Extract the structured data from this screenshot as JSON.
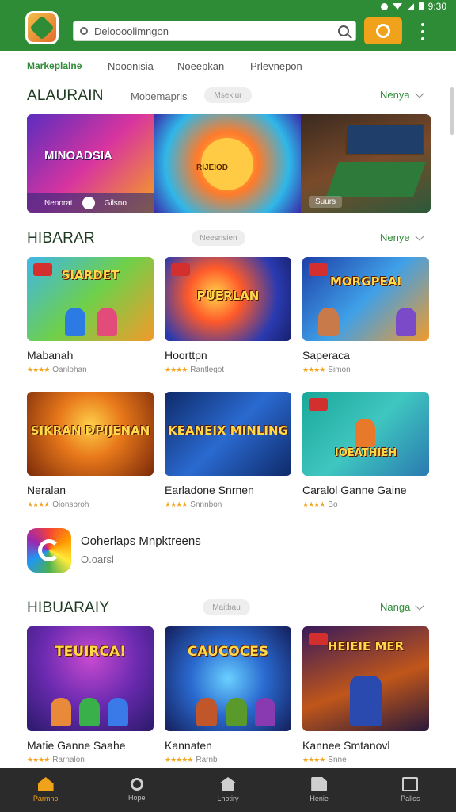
{
  "status": {
    "time": "9:30"
  },
  "header": {
    "search": {
      "value": "Deloooolimngon"
    }
  },
  "tabs": [
    {
      "label": "Markeplalne"
    },
    {
      "label": "Nooonisia"
    },
    {
      "label": "Noeepkan"
    },
    {
      "label": "Prlevnepon"
    }
  ],
  "section1": {
    "title": "ALAURAIN",
    "subtitle": "Mobemapris",
    "pill": "Msekiur",
    "more": "Nenya",
    "banner": {
      "title": "MINOADSIA",
      "footer_left": "Nenorat",
      "footer_right": "Gilsno",
      "center_label": "RIJEIOD",
      "tag": "Suurs"
    }
  },
  "section2": {
    "title": "HIBARAR",
    "pill": "Neesnsien",
    "more": "Nenye",
    "cards": [
      {
        "thumb_text": "SIARDET",
        "name": "Mabanah",
        "meta": "Oanlohan",
        "stars": "★★★★"
      },
      {
        "thumb_text": "PUERLAN",
        "name": "Hoorttpn",
        "meta": "Rantlegot",
        "stars": "★★★★"
      },
      {
        "thumb_text": "MORGPEAI",
        "name": "Saperaca",
        "meta": "Simon",
        "stars": "★★★★"
      },
      {
        "thumb_text": "SIKRAN DPIJENAN",
        "name": "Neralan",
        "meta": "Oionsbroh",
        "stars": "★★★★"
      },
      {
        "thumb_text": "KEANEIX MINLING",
        "name": "Earladone Snrnen",
        "meta": "Snnnbon",
        "stars": "★★★★"
      },
      {
        "thumb_text": "IOEATHIEH",
        "name": "Caralol Ganne Gaine",
        "meta": "Bo",
        "stars": "★★★★"
      }
    ]
  },
  "app_row": {
    "name": "Ooherlaps Mnpktreens",
    "meta": "O.oarsl"
  },
  "section3": {
    "title": "HIBUARAIY",
    "pill": "Maitbau",
    "more": "Nanga",
    "cards": [
      {
        "thumb_text": "TEUIRCA!",
        "name": "Matie Ganne Saahe",
        "meta": "Rarnalon",
        "stars": "★★★★"
      },
      {
        "thumb_text": "CAUCOCES",
        "name": "Kannaten",
        "meta": "Rarnb",
        "stars": "★★★★★"
      },
      {
        "thumb_text": "HEIEIE MER",
        "name": "Kannee Smtanovl",
        "meta": "Snne",
        "stars": "★★★★"
      }
    ]
  },
  "bottom_nav": [
    {
      "label": "Parmno",
      "icon": "home-icon"
    },
    {
      "label": "Hope",
      "icon": "search-icon"
    },
    {
      "label": "Lhotiry",
      "icon": "house-icon"
    },
    {
      "label": "Henie",
      "icon": "doc-icon"
    },
    {
      "label": "Pallos",
      "icon": "box-icon"
    }
  ],
  "colors": {
    "brand_green": "#2e8b36",
    "accent_orange": "#f0a21b",
    "nav_bg": "#2b2b2b"
  }
}
